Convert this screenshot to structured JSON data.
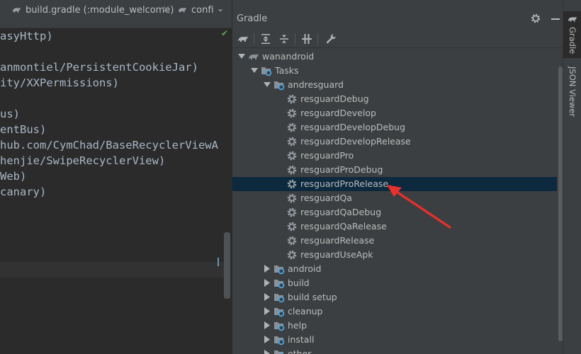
{
  "editor": {
    "tabs": [
      {
        "label": "build.gradle (:module_welcome)",
        "icon": "gradle-icon"
      },
      {
        "label": "confi",
        "icon": "gradle-icon"
      }
    ],
    "tab_close": "×",
    "overflow_glyph": "⌄",
    "check_glyph": "✔",
    "code_lines": [
      "asyHttp)",
      "",
      "anmontiel/PersistentCookieJar)",
      "ity/XXPermissions)",
      "",
      "us)",
      "entBus)",
      "hub.com/CymChad/BaseRecyclerViewA",
      "henjie/SwipeRecyclerView)",
      "Web)",
      "canary)"
    ]
  },
  "gradle_panel": {
    "title": "Gradle",
    "header_icons": [
      "gear-icon",
      "minimize-icon"
    ],
    "toolbar_icons": [
      "reimport-icon",
      "expand-all-icon",
      "collapse-all-icon",
      "toggle-offline-icon",
      "settings-wrench-icon"
    ],
    "tree": [
      {
        "label": "wanandroid",
        "depth": 0,
        "arrow": "expanded",
        "icon": "elephant-icon"
      },
      {
        "label": "Tasks",
        "depth": 1,
        "arrow": "expanded",
        "icon": "folder-gear-icon"
      },
      {
        "label": "andresguard",
        "depth": 2,
        "arrow": "expanded",
        "icon": "folder-gear-icon"
      },
      {
        "label": "resguardDebug",
        "depth": 3,
        "arrow": "none",
        "icon": "task-gear-icon"
      },
      {
        "label": "resguardDevelop",
        "depth": 3,
        "arrow": "none",
        "icon": "task-gear-icon"
      },
      {
        "label": "resguardDevelopDebug",
        "depth": 3,
        "arrow": "none",
        "icon": "task-gear-icon"
      },
      {
        "label": "resguardDevelopRelease",
        "depth": 3,
        "arrow": "none",
        "icon": "task-gear-icon"
      },
      {
        "label": "resguardPro",
        "depth": 3,
        "arrow": "none",
        "icon": "task-gear-icon"
      },
      {
        "label": "resguardProDebug",
        "depth": 3,
        "arrow": "none",
        "icon": "task-gear-icon"
      },
      {
        "label": "resguardProRelease",
        "depth": 3,
        "arrow": "none",
        "icon": "task-gear-icon",
        "selected": true
      },
      {
        "label": "resguardQa",
        "depth": 3,
        "arrow": "none",
        "icon": "task-gear-icon"
      },
      {
        "label": "resguardQaDebug",
        "depth": 3,
        "arrow": "none",
        "icon": "task-gear-icon"
      },
      {
        "label": "resguardQaRelease",
        "depth": 3,
        "arrow": "none",
        "icon": "task-gear-icon"
      },
      {
        "label": "resguardRelease",
        "depth": 3,
        "arrow": "none",
        "icon": "task-gear-icon"
      },
      {
        "label": "resguardUseApk",
        "depth": 3,
        "arrow": "none",
        "icon": "task-gear-icon"
      },
      {
        "label": "android",
        "depth": 2,
        "arrow": "collapsed",
        "icon": "folder-gear-icon"
      },
      {
        "label": "build",
        "depth": 2,
        "arrow": "collapsed",
        "icon": "folder-gear-icon"
      },
      {
        "label": "build setup",
        "depth": 2,
        "arrow": "collapsed",
        "icon": "folder-gear-icon"
      },
      {
        "label": "cleanup",
        "depth": 2,
        "arrow": "collapsed",
        "icon": "folder-gear-icon"
      },
      {
        "label": "help",
        "depth": 2,
        "arrow": "collapsed",
        "icon": "folder-gear-icon"
      },
      {
        "label": "install",
        "depth": 2,
        "arrow": "collapsed",
        "icon": "folder-gear-icon"
      },
      {
        "label": "other",
        "depth": 2,
        "arrow": "collapsed",
        "icon": "folder-gear-icon"
      }
    ]
  },
  "side_stripe": {
    "tabs": [
      {
        "label": "Gradle",
        "icon": "elephant-icon",
        "active": true
      },
      {
        "label": "JSON Viewer",
        "icon": "",
        "active": false
      }
    ]
  },
  "annotation": {
    "icon": "red-arrow-icon",
    "color": "#e8302c"
  },
  "colors": {
    "panel_bg": "#3c3f41",
    "editor_bg": "#2b2b2b",
    "selection": "#0d293e",
    "text": "#bbbbbb",
    "code_text": "#a9b7c6"
  }
}
